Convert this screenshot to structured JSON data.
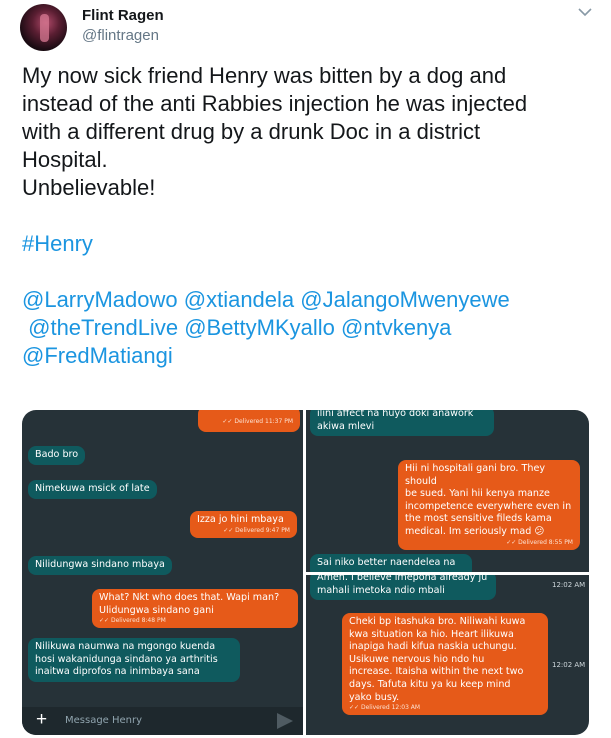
{
  "user": {
    "name": "Flint Ragen",
    "handle": "@flintragen"
  },
  "tweet": {
    "line1": "My now sick friend Henry was bitten by a dog and",
    "line2": "instead of the anti Rabbies injection he was injected",
    "line3": "with a different drug by a drunk Doc in a district",
    "line4": "Hospital.",
    "line5": "Unbelievable!",
    "hashtag": "#Henry",
    "mentions": {
      "m1": "@LarryMadowo",
      "m2": "@xtiandela",
      "m3": "@JalangoMwenyewe",
      "m4": "@theTrendLive",
      "m5": "@BettyMKyallo",
      "m6": "@ntvkenya",
      "m7": "@FredMatiangi"
    }
  },
  "chat_left": {
    "msg0_meta": "✓✓ Delivered 11:37 PM",
    "msg1": "Bado bro",
    "msg2": "Nimekuwa msick of late",
    "msg3": "Izza jo hini mbaya",
    "msg3_meta": "✓✓ Delivered 9:47 PM",
    "msg4": "Nilidungwa sindano mbaya",
    "msg5_l1": "What? Nkt who does that. Wapi man?",
    "msg5_l2": "Ulidungwa sindano gani",
    "msg5_meta": "✓✓ Delivered 8:48 PM",
    "msg6_l1": "Nilikuwa naumwa na mgongo kuenda",
    "msg6_l2": "hosi wakanidunga sindano ya arthritis",
    "msg6_l3": "inaitwa diprofos na inimbaya sana",
    "composer_placeholder": "Message Henry"
  },
  "chat_top_right": {
    "msg1_l1": "ilini affect na huyo doki anawork",
    "msg1_l2": "akiwa mlevi",
    "msg2_l1": "Hii ni hospitali gani bro. They should",
    "msg2_l2": "be sued. Yani hii kenya manze",
    "msg2_l3": "incompetence everywhere even in",
    "msg2_l4": "the most sensitive fileds kama",
    "msg2_l5": "medical. Im seriously mad 😕",
    "msg2_meta": "✓✓ Delivered 8:55 PM",
    "msg3": "Sai niko better naendelea na"
  },
  "chat_bottom_right": {
    "msg1_l1": "Ameh. I believe imepona already ju",
    "msg1_l2": "mahali imetoka ndio mbali",
    "time1": "12:02 AM",
    "msg2_l1": "Cheki bp itashuka bro. Niliwahi kuwa",
    "msg2_l2": "kwa situation ka hio. Heart ilikuwa",
    "msg2_l3": "inapiga hadi kifua naskia uchungu.",
    "msg2_l4": "Usikuwe nervous hio ndo hu",
    "msg2_l5": "increase. Itaisha within the next two",
    "msg2_l6": "days. Tafuta kitu ya ku keep mind",
    "msg2_l7": "yako busy.",
    "msg2_meta": "✓✓ Delivered 12:03 AM",
    "time2": "12:02 AM"
  }
}
